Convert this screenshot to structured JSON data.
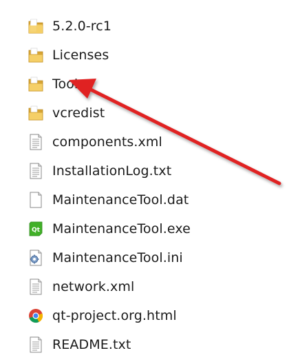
{
  "file_list": {
    "items": [
      {
        "name": "5.2.0-rc1",
        "type": "folder",
        "icon": "folder-icon"
      },
      {
        "name": "Licenses",
        "type": "folder",
        "icon": "folder-icon"
      },
      {
        "name": "Tools",
        "type": "folder",
        "icon": "folder-icon"
      },
      {
        "name": "vcredist",
        "type": "folder",
        "icon": "folder-icon"
      },
      {
        "name": "components.xml",
        "type": "file",
        "icon": "text-file-icon"
      },
      {
        "name": "InstallationLog.txt",
        "type": "file",
        "icon": "text-file-icon"
      },
      {
        "name": "MaintenanceTool.dat",
        "type": "file",
        "icon": "blank-file-icon"
      },
      {
        "name": "MaintenanceTool.exe",
        "type": "file",
        "icon": "qt-exe-icon"
      },
      {
        "name": "MaintenanceTool.ini",
        "type": "file",
        "icon": "settings-file-icon"
      },
      {
        "name": "network.xml",
        "type": "file",
        "icon": "text-file-icon"
      },
      {
        "name": "qt-project.org.html",
        "type": "file",
        "icon": "chrome-html-icon"
      },
      {
        "name": "README.txt",
        "type": "file",
        "icon": "text-file-icon"
      }
    ]
  },
  "annotation": {
    "icon": "red-arrow-icon",
    "color": "#e02020",
    "points_to": "Tools"
  },
  "colors": {
    "folder": "#e8b84a",
    "qt_green": "#41b028"
  }
}
